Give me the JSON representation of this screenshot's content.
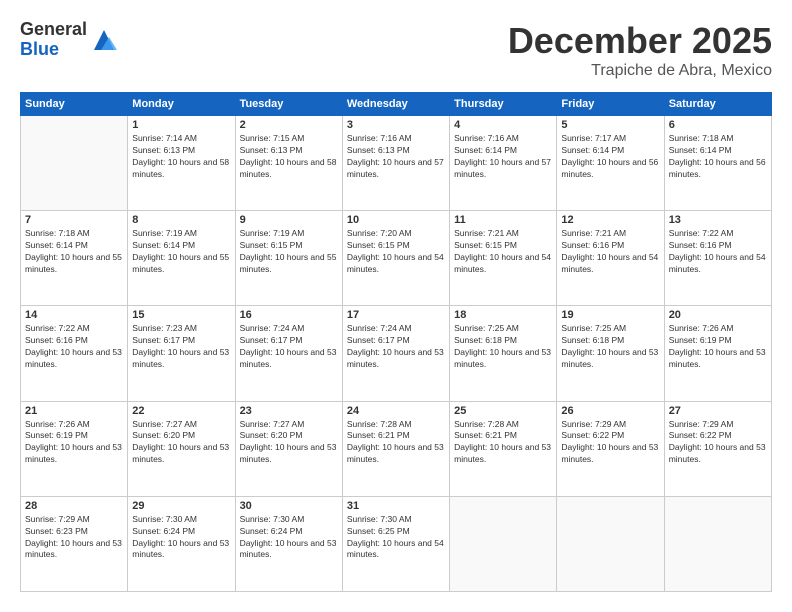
{
  "logo": {
    "general": "General",
    "blue": "Blue"
  },
  "header": {
    "month": "December 2025",
    "location": "Trapiche de Abra, Mexico"
  },
  "weekdays": [
    "Sunday",
    "Monday",
    "Tuesday",
    "Wednesday",
    "Thursday",
    "Friday",
    "Saturday"
  ],
  "weeks": [
    [
      {
        "day": "",
        "sunrise": "",
        "sunset": "",
        "daylight": ""
      },
      {
        "day": "1",
        "sunrise": "Sunrise: 7:14 AM",
        "sunset": "Sunset: 6:13 PM",
        "daylight": "Daylight: 10 hours and 58 minutes."
      },
      {
        "day": "2",
        "sunrise": "Sunrise: 7:15 AM",
        "sunset": "Sunset: 6:13 PM",
        "daylight": "Daylight: 10 hours and 58 minutes."
      },
      {
        "day": "3",
        "sunrise": "Sunrise: 7:16 AM",
        "sunset": "Sunset: 6:13 PM",
        "daylight": "Daylight: 10 hours and 57 minutes."
      },
      {
        "day": "4",
        "sunrise": "Sunrise: 7:16 AM",
        "sunset": "Sunset: 6:14 PM",
        "daylight": "Daylight: 10 hours and 57 minutes."
      },
      {
        "day": "5",
        "sunrise": "Sunrise: 7:17 AM",
        "sunset": "Sunset: 6:14 PM",
        "daylight": "Daylight: 10 hours and 56 minutes."
      },
      {
        "day": "6",
        "sunrise": "Sunrise: 7:18 AM",
        "sunset": "Sunset: 6:14 PM",
        "daylight": "Daylight: 10 hours and 56 minutes."
      }
    ],
    [
      {
        "day": "7",
        "sunrise": "Sunrise: 7:18 AM",
        "sunset": "Sunset: 6:14 PM",
        "daylight": "Daylight: 10 hours and 55 minutes."
      },
      {
        "day": "8",
        "sunrise": "Sunrise: 7:19 AM",
        "sunset": "Sunset: 6:14 PM",
        "daylight": "Daylight: 10 hours and 55 minutes."
      },
      {
        "day": "9",
        "sunrise": "Sunrise: 7:19 AM",
        "sunset": "Sunset: 6:15 PM",
        "daylight": "Daylight: 10 hours and 55 minutes."
      },
      {
        "day": "10",
        "sunrise": "Sunrise: 7:20 AM",
        "sunset": "Sunset: 6:15 PM",
        "daylight": "Daylight: 10 hours and 54 minutes."
      },
      {
        "day": "11",
        "sunrise": "Sunrise: 7:21 AM",
        "sunset": "Sunset: 6:15 PM",
        "daylight": "Daylight: 10 hours and 54 minutes."
      },
      {
        "day": "12",
        "sunrise": "Sunrise: 7:21 AM",
        "sunset": "Sunset: 6:16 PM",
        "daylight": "Daylight: 10 hours and 54 minutes."
      },
      {
        "day": "13",
        "sunrise": "Sunrise: 7:22 AM",
        "sunset": "Sunset: 6:16 PM",
        "daylight": "Daylight: 10 hours and 54 minutes."
      }
    ],
    [
      {
        "day": "14",
        "sunrise": "Sunrise: 7:22 AM",
        "sunset": "Sunset: 6:16 PM",
        "daylight": "Daylight: 10 hours and 53 minutes."
      },
      {
        "day": "15",
        "sunrise": "Sunrise: 7:23 AM",
        "sunset": "Sunset: 6:17 PM",
        "daylight": "Daylight: 10 hours and 53 minutes."
      },
      {
        "day": "16",
        "sunrise": "Sunrise: 7:24 AM",
        "sunset": "Sunset: 6:17 PM",
        "daylight": "Daylight: 10 hours and 53 minutes."
      },
      {
        "day": "17",
        "sunrise": "Sunrise: 7:24 AM",
        "sunset": "Sunset: 6:17 PM",
        "daylight": "Daylight: 10 hours and 53 minutes."
      },
      {
        "day": "18",
        "sunrise": "Sunrise: 7:25 AM",
        "sunset": "Sunset: 6:18 PM",
        "daylight": "Daylight: 10 hours and 53 minutes."
      },
      {
        "day": "19",
        "sunrise": "Sunrise: 7:25 AM",
        "sunset": "Sunset: 6:18 PM",
        "daylight": "Daylight: 10 hours and 53 minutes."
      },
      {
        "day": "20",
        "sunrise": "Sunrise: 7:26 AM",
        "sunset": "Sunset: 6:19 PM",
        "daylight": "Daylight: 10 hours and 53 minutes."
      }
    ],
    [
      {
        "day": "21",
        "sunrise": "Sunrise: 7:26 AM",
        "sunset": "Sunset: 6:19 PM",
        "daylight": "Daylight: 10 hours and 53 minutes."
      },
      {
        "day": "22",
        "sunrise": "Sunrise: 7:27 AM",
        "sunset": "Sunset: 6:20 PM",
        "daylight": "Daylight: 10 hours and 53 minutes."
      },
      {
        "day": "23",
        "sunrise": "Sunrise: 7:27 AM",
        "sunset": "Sunset: 6:20 PM",
        "daylight": "Daylight: 10 hours and 53 minutes."
      },
      {
        "day": "24",
        "sunrise": "Sunrise: 7:28 AM",
        "sunset": "Sunset: 6:21 PM",
        "daylight": "Daylight: 10 hours and 53 minutes."
      },
      {
        "day": "25",
        "sunrise": "Sunrise: 7:28 AM",
        "sunset": "Sunset: 6:21 PM",
        "daylight": "Daylight: 10 hours and 53 minutes."
      },
      {
        "day": "26",
        "sunrise": "Sunrise: 7:29 AM",
        "sunset": "Sunset: 6:22 PM",
        "daylight": "Daylight: 10 hours and 53 minutes."
      },
      {
        "day": "27",
        "sunrise": "Sunrise: 7:29 AM",
        "sunset": "Sunset: 6:22 PM",
        "daylight": "Daylight: 10 hours and 53 minutes."
      }
    ],
    [
      {
        "day": "28",
        "sunrise": "Sunrise: 7:29 AM",
        "sunset": "Sunset: 6:23 PM",
        "daylight": "Daylight: 10 hours and 53 minutes."
      },
      {
        "day": "29",
        "sunrise": "Sunrise: 7:30 AM",
        "sunset": "Sunset: 6:24 PM",
        "daylight": "Daylight: 10 hours and 53 minutes."
      },
      {
        "day": "30",
        "sunrise": "Sunrise: 7:30 AM",
        "sunset": "Sunset: 6:24 PM",
        "daylight": "Daylight: 10 hours and 53 minutes."
      },
      {
        "day": "31",
        "sunrise": "Sunrise: 7:30 AM",
        "sunset": "Sunset: 6:25 PM",
        "daylight": "Daylight: 10 hours and 54 minutes."
      },
      {
        "day": "",
        "sunrise": "",
        "sunset": "",
        "daylight": ""
      },
      {
        "day": "",
        "sunrise": "",
        "sunset": "",
        "daylight": ""
      },
      {
        "day": "",
        "sunrise": "",
        "sunset": "",
        "daylight": ""
      }
    ]
  ]
}
